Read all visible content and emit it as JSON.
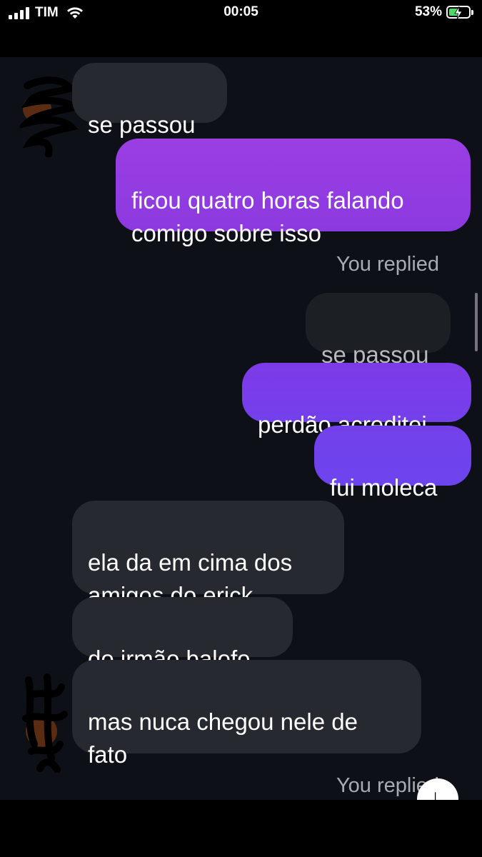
{
  "status_bar": {
    "carrier": "TIM",
    "time": "00:05",
    "battery_percent": "53%",
    "battery_level": 0.53
  },
  "messages": [
    {
      "text": "se passou",
      "direction": "incoming"
    },
    {
      "text": "ficou quatro horas falando\ncomigo sobre isso",
      "direction": "outgoing"
    },
    {
      "label": "You replied"
    },
    {
      "text": "se passou",
      "direction": "reply-reference"
    },
    {
      "text": "perdão acreditei",
      "direction": "outgoing"
    },
    {
      "text": "fui moleca",
      "direction": "outgoing"
    },
    {
      "text": "ela da em cima dos\namigos do erick",
      "direction": "incoming"
    },
    {
      "text": "do irmão balofo",
      "direction": "incoming"
    },
    {
      "text": "mas nuca chegou nele de\nfato",
      "direction": "incoming"
    },
    {
      "label": "You replied"
    }
  ],
  "icons": {
    "signal": "cellular-signal-icon",
    "wifi": "wifi-icon",
    "battery": "battery-charging-icon",
    "avatar": "contact-avatar-icon",
    "scroll_down": "scroll-down-icon"
  },
  "colors": {
    "incoming_bubble": "#262a30",
    "outgoing_purple": "#9a3ee3",
    "outgoing_violet": "#7341ea",
    "background": "#0d1016"
  }
}
